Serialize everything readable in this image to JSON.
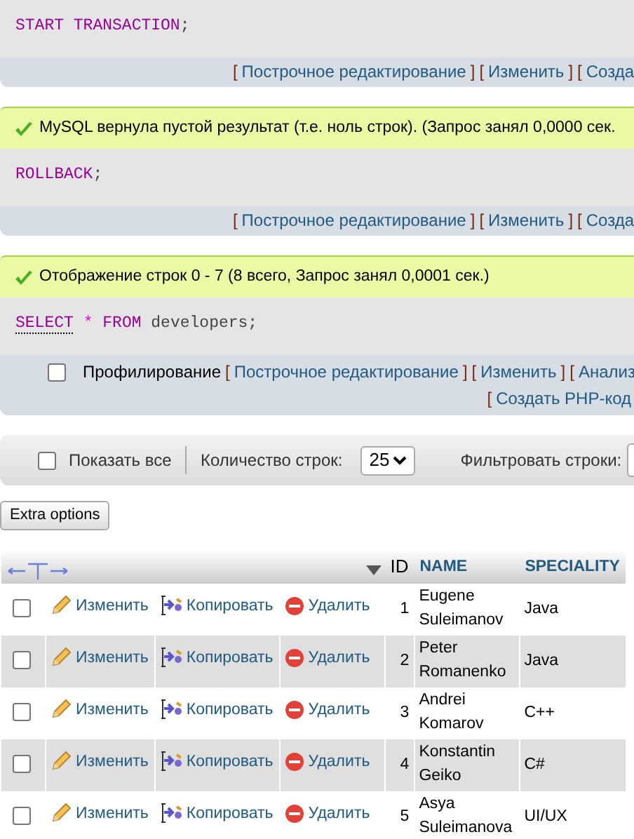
{
  "blocks": [
    {
      "sql": [
        {
          "kind": "keyword",
          "text": "START TRANSACTION"
        },
        {
          "kind": "punct",
          "text": ";"
        }
      ],
      "links": [
        {
          "before": "[",
          "label": "Построчное редактирование",
          "after": "]"
        },
        {
          "before": "[",
          "label": "Изменить",
          "after": "]"
        },
        {
          "before": "[",
          "label": "Созда"
        }
      ]
    },
    {
      "message": "MySQL вернула пустой результат (т.е. ноль строк). (Запрос занял 0,0000 сек.",
      "sql": [
        {
          "kind": "keyword",
          "text": "ROLLBACK"
        },
        {
          "kind": "punct",
          "text": ";"
        }
      ],
      "links": [
        {
          "before": "[",
          "label": "Построчное редактирование",
          "after": "]"
        },
        {
          "before": "[",
          "label": "Изменить",
          "after": "]"
        },
        {
          "before": "[",
          "label": "Созда"
        }
      ]
    },
    {
      "message": "Отображение строк 0 - 7 (8 всего, Запрос занял 0,0001 сек.)",
      "sql": [
        {
          "kind": "function",
          "text": "SELECT"
        },
        {
          "kind": "operator",
          "text": "*"
        },
        {
          "kind": "keyword",
          "text": "FROM"
        },
        {
          "kind": "identifier",
          "text": "developers"
        },
        {
          "kind": "punct",
          "text": ";"
        }
      ],
      "profiling": {
        "label": "Профилирование",
        "checked": false
      },
      "links": [
        {
          "before": "[",
          "label": "Построчное редактирование",
          "after": "]"
        },
        {
          "before": "[",
          "label": "Изменить",
          "after": "]"
        },
        {
          "before": "[",
          "label": "Анализ"
        }
      ],
      "links_2": [
        {
          "before": "[",
          "label": "Создать PHP-код"
        }
      ]
    }
  ],
  "toolbar": {
    "show_all": {
      "label": "Показать все",
      "checked": false
    },
    "rows_label": "Количество строк:",
    "rows_value": "25",
    "filter_label": "Фильтровать строки:"
  },
  "extra_options": "Extra options",
  "table": {
    "columns": [
      "ID",
      "NAME",
      "SPECIALITY"
    ],
    "rows": [
      {
        "checked": false,
        "actions": [
          "Изменить",
          "Копировать",
          "Удалить"
        ],
        "id": "1",
        "name": "Eugene Suleimanov",
        "speciality": "Java"
      },
      {
        "checked": false,
        "actions": [
          "Изменить",
          "Копировать",
          "Удалить"
        ],
        "id": "2",
        "name": "Peter Romanenko",
        "speciality": "Java"
      },
      {
        "checked": false,
        "actions": [
          "Изменить",
          "Копировать",
          "Удалить"
        ],
        "id": "3",
        "name": "Andrei Komarov",
        "speciality": "C++"
      },
      {
        "checked": false,
        "actions": [
          "Изменить",
          "Копировать",
          "Удалить"
        ],
        "id": "4",
        "name": "Konstantin Geiko",
        "speciality": "C#"
      },
      {
        "checked": false,
        "actions": [
          "Изменить",
          "Копировать",
          "Удалить"
        ],
        "id": "5",
        "name": "Asya Suleimanova",
        "speciality": "UI/UX"
      }
    ]
  }
}
